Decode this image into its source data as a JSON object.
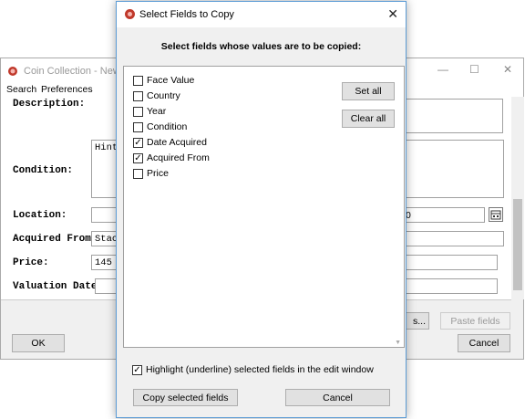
{
  "background_window": {
    "title": "Coin Collection - New Re",
    "menu": [
      "Search",
      "Preferences"
    ],
    "labels": {
      "description": "Description:",
      "condition": "Condition:",
      "location": "Location:",
      "acquired_from": "Acquired From:",
      "price": "Price:",
      "valuation_date": "Valuation Date:"
    },
    "values": {
      "condition": "Hint",
      "acquired_from": "Stac",
      "price": "145",
      "location_right": "0"
    },
    "buttons": {
      "copy_fields_partial": "s...",
      "paste_fields": "Paste fields",
      "ok": "OK",
      "cancel": "Cancel"
    }
  },
  "dialog": {
    "title": "Select Fields to Copy",
    "heading": "Select fields whose values are to be copied:",
    "fields": [
      {
        "label": "Face Value",
        "checked": false
      },
      {
        "label": "Country",
        "checked": false
      },
      {
        "label": "Year",
        "checked": false
      },
      {
        "label": "Condition",
        "checked": false
      },
      {
        "label": "Date Acquired",
        "checked": true
      },
      {
        "label": "Acquired From",
        "checked": true
      },
      {
        "label": "Price",
        "checked": false
      }
    ],
    "set_all_label": "Set all",
    "clear_all_label": "Clear all",
    "highlight_label": "Highlight (underline) selected fields in the edit window",
    "highlight_checked": true,
    "copy_button_label": "Copy selected fields",
    "cancel_button_label": "Cancel"
  },
  "colors": {
    "app_icon": "#c0392b",
    "dialog_border": "#5b9bd5"
  }
}
